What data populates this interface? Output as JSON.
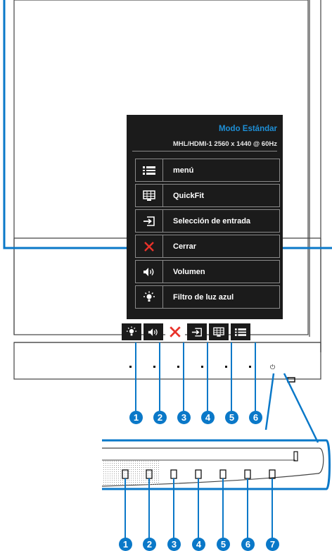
{
  "osd": {
    "mode_title": "Modo Estándar",
    "resolution": "MHL/HDMI-1  2560 x 1440 @ 60Hz",
    "items": [
      {
        "label": "menú",
        "icon": "menu-icon"
      },
      {
        "label": "QuickFit",
        "icon": "quickfit-icon"
      },
      {
        "label": "Selección de entrada",
        "icon": "input-select-icon"
      },
      {
        "label": "Cerrar",
        "icon": "close-icon"
      },
      {
        "label": "Volumen",
        "icon": "volume-icon"
      },
      {
        "label": "Filtro de luz azul",
        "icon": "blue-light-icon"
      }
    ]
  },
  "keybar_icons": [
    "blue-light-icon",
    "volume-icon",
    "close-icon",
    "input-select-icon",
    "quickfit-icon",
    "menu-icon"
  ],
  "power_symbol": "⏻",
  "top_callouts": [
    "1",
    "2",
    "3",
    "4",
    "5",
    "6"
  ],
  "bottom_callouts": [
    "1",
    "2",
    "3",
    "4",
    "5",
    "6",
    "7"
  ],
  "colors": {
    "frame": "#0a78c8",
    "osd_bg": "#1b1b1b",
    "accent": "#1e8fd6",
    "close": "#e8322a",
    "badge": "#0a78c8"
  }
}
